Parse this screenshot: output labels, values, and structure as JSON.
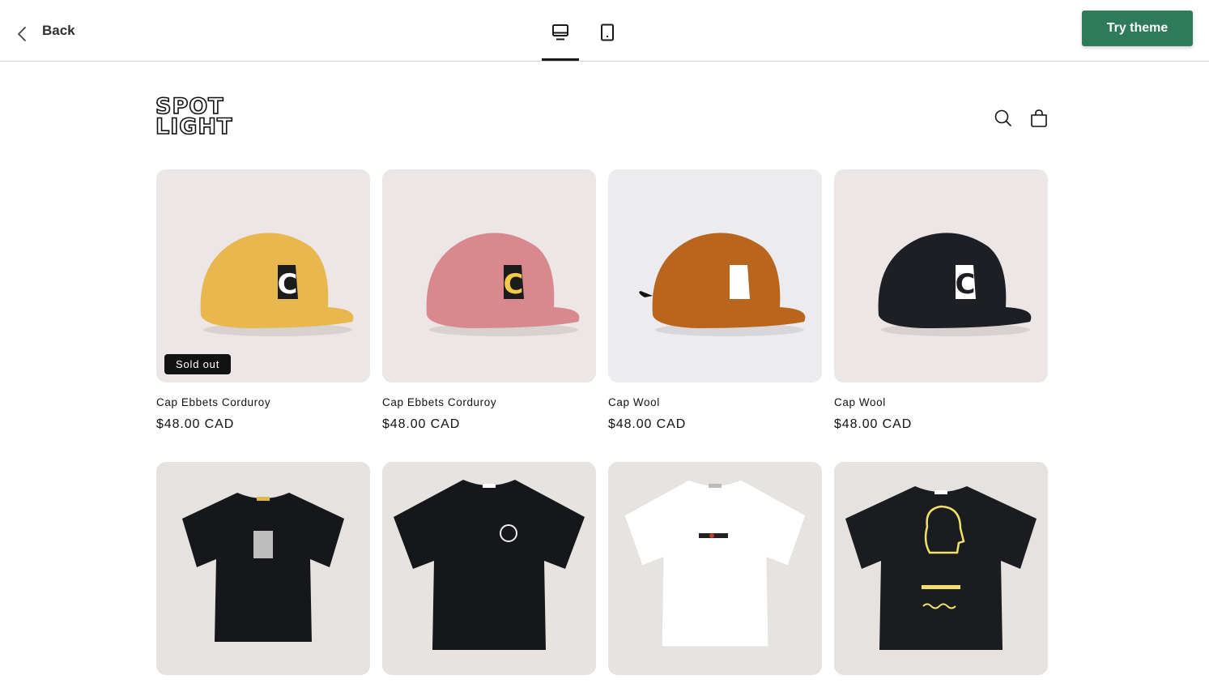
{
  "preview_bar": {
    "back_label": "Back",
    "desktop_view": "desktop-icon",
    "mobile_view": "mobile-icon",
    "try_button": "Try theme",
    "try_button_color": "#2f7a5a"
  },
  "store": {
    "logo_line1": "SPOT",
    "logo_line2": "LIGHT",
    "icons": [
      "search-icon",
      "cart-icon"
    ]
  },
  "products": [
    {
      "title": "Cap Ebbets Corduroy",
      "price": "$48.00 CAD",
      "badge": "Sold out",
      "color": "#e8b84f"
    },
    {
      "title": "Cap Ebbets Corduroy",
      "price": "$48.00 CAD",
      "badge": "",
      "color": "#d9888e"
    },
    {
      "title": "Cap Wool",
      "price": "$48.00 CAD",
      "badge": "",
      "color": "#b9651e"
    },
    {
      "title": "Cap Wool",
      "price": "$48.00 CAD",
      "badge": "",
      "color": "#1d1f24"
    },
    {
      "title": "",
      "price": "",
      "badge": "",
      "color": "#15171b"
    },
    {
      "title": "",
      "price": "",
      "badge": "",
      "color": "#15171b"
    },
    {
      "title": "",
      "price": "",
      "badge": "",
      "color": "#ffffff"
    },
    {
      "title": "",
      "price": "",
      "badge": "",
      "color": "#1a1c20"
    }
  ]
}
